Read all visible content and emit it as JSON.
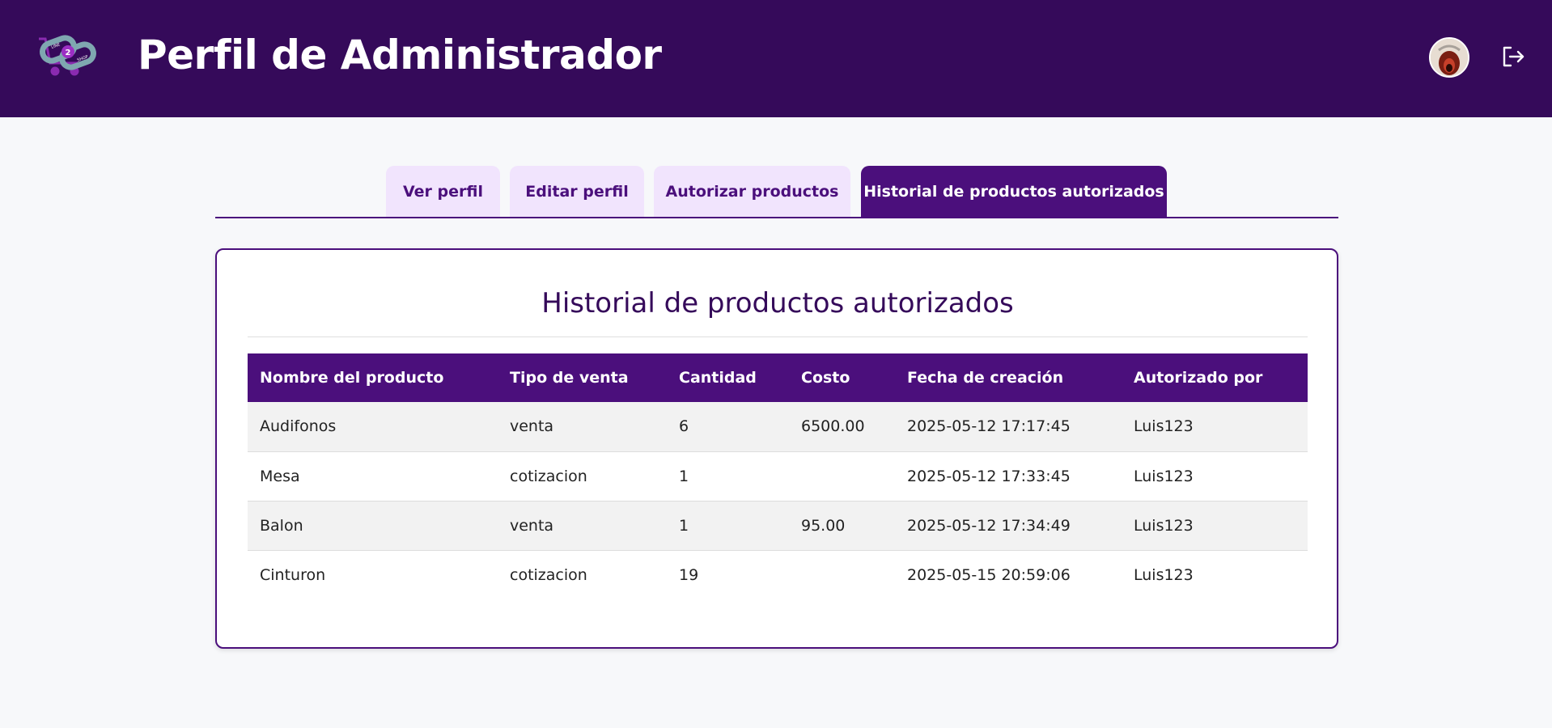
{
  "header": {
    "title": "Perfil de Administrador",
    "logo_text_top": "LINE",
    "logo_text_mid": "2",
    "logo_text_bot": "SHOP"
  },
  "tabs": [
    {
      "label": "Ver perfil"
    },
    {
      "label": "Editar perfil"
    },
    {
      "label": "Autorizar productos"
    },
    {
      "label": "Historial de productos autorizados",
      "active": true
    }
  ],
  "content": {
    "title": "Historial de productos autorizados",
    "columns": [
      "Nombre del producto",
      "Tipo de venta",
      "Cantidad",
      "Costo",
      "Fecha de creación",
      "Autorizado por"
    ],
    "rows": [
      [
        "Audifonos",
        "venta",
        "6",
        "6500.00",
        "2025-05-12 17:17:45",
        "Luis123"
      ],
      [
        "Mesa",
        "cotizacion",
        "1",
        "",
        "2025-05-12 17:33:45",
        "Luis123"
      ],
      [
        "Balon",
        "venta",
        "1",
        "95.00",
        "2025-05-12 17:34:49",
        "Luis123"
      ],
      [
        "Cinturon",
        "cotizacion",
        "19",
        "",
        "2025-05-15 20:59:06",
        "Luis123"
      ]
    ]
  },
  "icons": {
    "logo": "cart-link-logo-icon",
    "avatar": "user-avatar",
    "logout": "logout-icon"
  },
  "colors": {
    "header_bg": "#350a5a",
    "accent": "#4b0f7c",
    "tab_inactive_bg": "#f1e4fd",
    "page_bg": "#f7f8fa"
  }
}
